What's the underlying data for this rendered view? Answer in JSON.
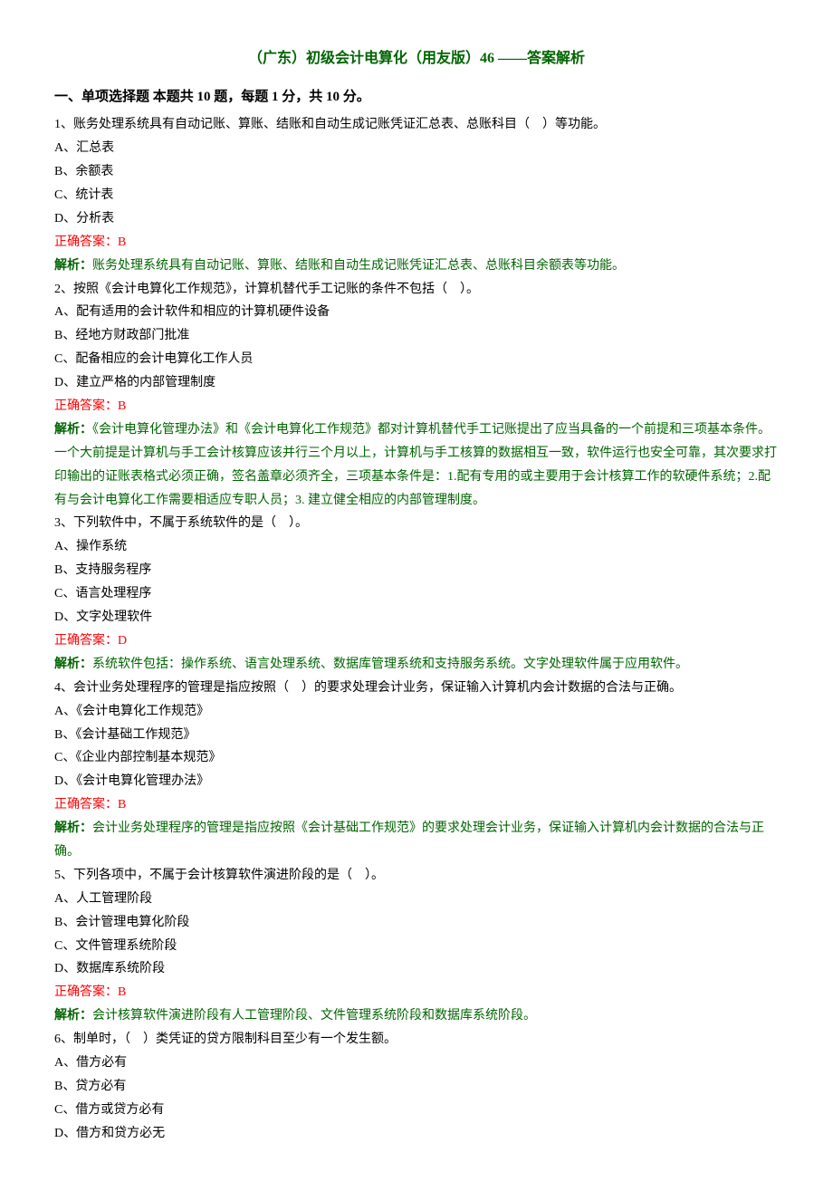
{
  "title": "（广东）初级会计电算化（用友版）46 ——答案解析",
  "sectionHeader": "一、单项选择题  本题共 10 题，每题 1 分，共 10 分。",
  "answerPrefix": "正确答案：",
  "analysisPrefix": "解析：",
  "questions": [
    {
      "stem": "1、账务处理系统具有自动记账、算账、结账和自动生成记账凭证汇总表、总账科目（　）等功能。",
      "options": [
        "A、汇总表",
        "B、余额表",
        "C、统计表",
        "D、分析表"
      ],
      "answer": "B",
      "analysis": "账务处理系统具有自动记账、算账、结账和自动生成记账凭证汇总表、总账科目余额表等功能。"
    },
    {
      "stem": "2、按照《会计电算化工作规范》，计算机替代手工记账的条件不包括（　）。",
      "options": [
        "A、配有适用的会计软件和相应的计算机硬件设备",
        "B、经地方财政部门批准",
        "C、配备相应的会计电算化工作人员",
        "D、建立严格的内部管理制度"
      ],
      "answer": "B",
      "analysis": "《会计电算化管理办法》和《会计电算化工作规范》都对计算机替代手工记账提出了应当具备的一个前提和三项基本条件。一个大前提是计算机与手工会计核算应该并行三个月以上，计算机与手工核算的数据相互一致，软件运行也安全可靠，其次要求打印输出的证账表格式必须正确，签名盖章必须齐全，三项基本条件是：1.配有专用的或主要用于会计核算工作的软硬件系统；2.配有与会计电算化工作需要相适应专职人员；3. 建立健全相应的内部管理制度。"
    },
    {
      "stem": "3、下列软件中，不属于系统软件的是（　）。",
      "options": [
        "A、操作系统",
        "B、支持服务程序",
        "C、语言处理程序",
        "D、文字处理软件"
      ],
      "answer": "D",
      "analysis": "系统软件包括：操作系统、语言处理系统、数据库管理系统和支持服务系统。文字处理软件属于应用软件。"
    },
    {
      "stem": "4、会计业务处理程序的管理是指应按照（　）的要求处理会计业务，保证输入计算机内会计数据的合法与正确。",
      "options": [
        "A、《会计电算化工作规范》",
        "B、《会计基础工作规范》",
        "C、《企业内部控制基本规范》",
        "D、《会计电算化管理办法》"
      ],
      "answer": "B",
      "analysis": "会计业务处理程序的管理是指应按照《会计基础工作规范》的要求处理会计业务，保证输入计算机内会计数据的合法与正确。"
    },
    {
      "stem": "5、下列各项中，不属于会计核算软件演进阶段的是（　）。",
      "options": [
        "A、人工管理阶段",
        "B、会计管理电算化阶段",
        "C、文件管理系统阶段",
        "D、数据库系统阶段"
      ],
      "answer": "B",
      "analysis": "会计核算软件演进阶段有人工管理阶段、文件管理系统阶段和数据库系统阶段。"
    },
    {
      "stem": "6、制单时，（　）类凭证的贷方限制科目至少有一个发生额。",
      "options": [
        "A、借方必有",
        "B、贷方必有",
        "C、借方或贷方必有",
        "D、借方和贷方必无"
      ],
      "answer": null,
      "analysis": null
    }
  ]
}
